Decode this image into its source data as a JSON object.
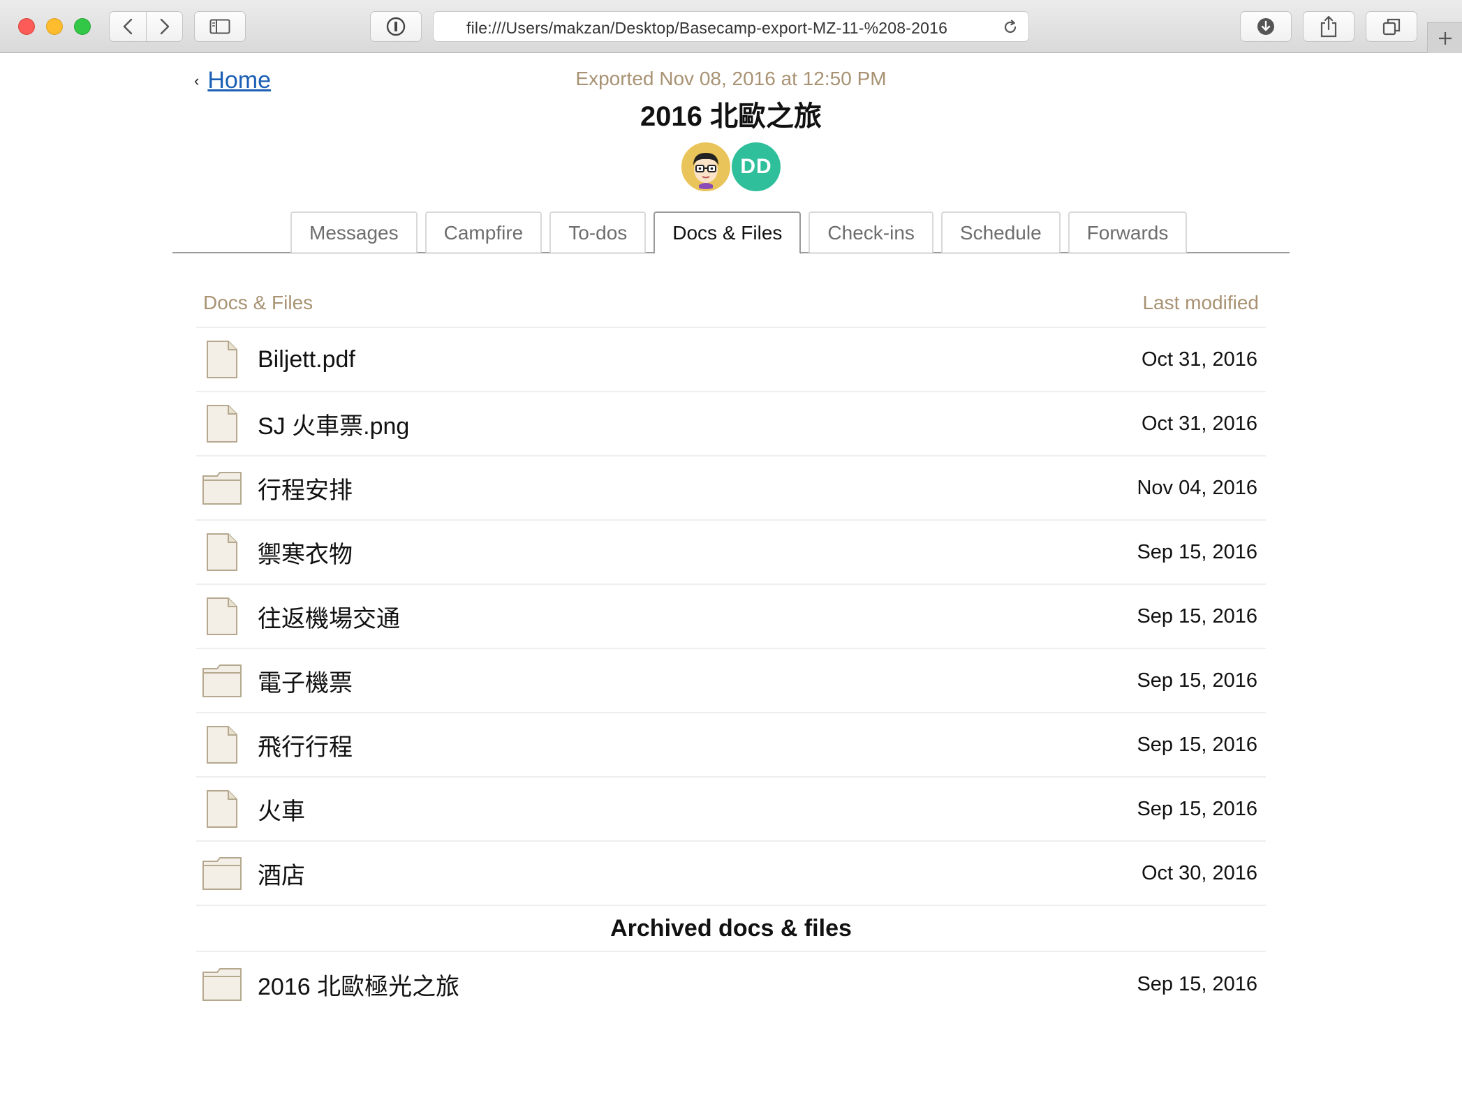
{
  "browser": {
    "url": "file:///Users/makzan/Desktop/Basecamp-export-MZ-11-%208-2016"
  },
  "header": {
    "home_label": "Home",
    "home_chevron": "‹",
    "exported": "Exported Nov 08, 2016 at 12:50 PM",
    "title": "2016 北歐之旅",
    "avatars": [
      {
        "type": "image",
        "icon": "cartoon-face-avatar"
      },
      {
        "type": "initials",
        "initials": "DD",
        "color": "#2fbf9b"
      }
    ]
  },
  "tabs": [
    {
      "label": "Messages",
      "active": false
    },
    {
      "label": "Campfire",
      "active": false
    },
    {
      "label": "To-dos",
      "active": false
    },
    {
      "label": "Docs & Files",
      "active": true
    },
    {
      "label": "Check-ins",
      "active": false
    },
    {
      "label": "Schedule",
      "active": false
    },
    {
      "label": "Forwards",
      "active": false
    }
  ],
  "list": {
    "col_name": "Docs & Files",
    "col_date": "Last modified",
    "items": [
      {
        "type": "file",
        "name": "Biljett.pdf",
        "date": "Oct 31, 2016"
      },
      {
        "type": "file",
        "name": "SJ 火車票.png",
        "date": "Oct 31, 2016"
      },
      {
        "type": "folder",
        "name": "行程安排",
        "date": "Nov 04, 2016"
      },
      {
        "type": "file",
        "name": "禦寒衣物",
        "date": "Sep 15, 2016"
      },
      {
        "type": "file",
        "name": "往返機場交通",
        "date": "Sep 15, 2016"
      },
      {
        "type": "folder",
        "name": "電子機票",
        "date": "Sep 15, 2016"
      },
      {
        "type": "file",
        "name": "飛行行程",
        "date": "Sep 15, 2016"
      },
      {
        "type": "file",
        "name": "火車",
        "date": "Sep 15, 2016"
      },
      {
        "type": "folder",
        "name": "酒店",
        "date": "Oct 30, 2016"
      }
    ]
  },
  "archived": {
    "title": "Archived docs & files",
    "items": [
      {
        "type": "folder",
        "name": "2016 北歐極光之旅",
        "date": "Sep 15, 2016"
      }
    ]
  },
  "colors": {
    "accent_muted": "#a89273",
    "link": "#1a5fb4"
  }
}
